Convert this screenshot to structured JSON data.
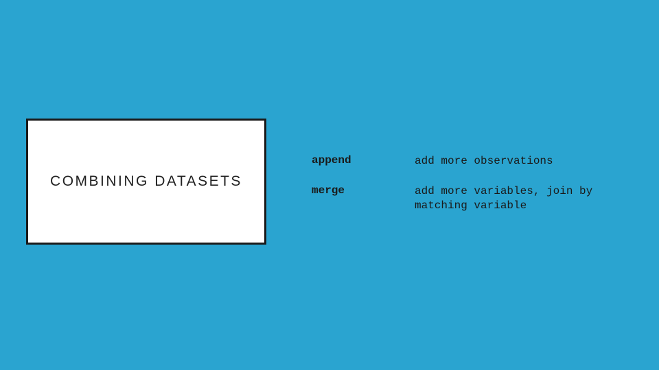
{
  "slide": {
    "title": "COMBINING DATASETS",
    "commands": [
      {
        "name": "append",
        "desc": "add more observations"
      },
      {
        "name": "merge",
        "desc": "add more variables, join by matching variable"
      }
    ],
    "colors": {
      "background": "#2aa4d0",
      "box_bg": "#ffffff",
      "box_border": "#1a1a1a"
    }
  }
}
